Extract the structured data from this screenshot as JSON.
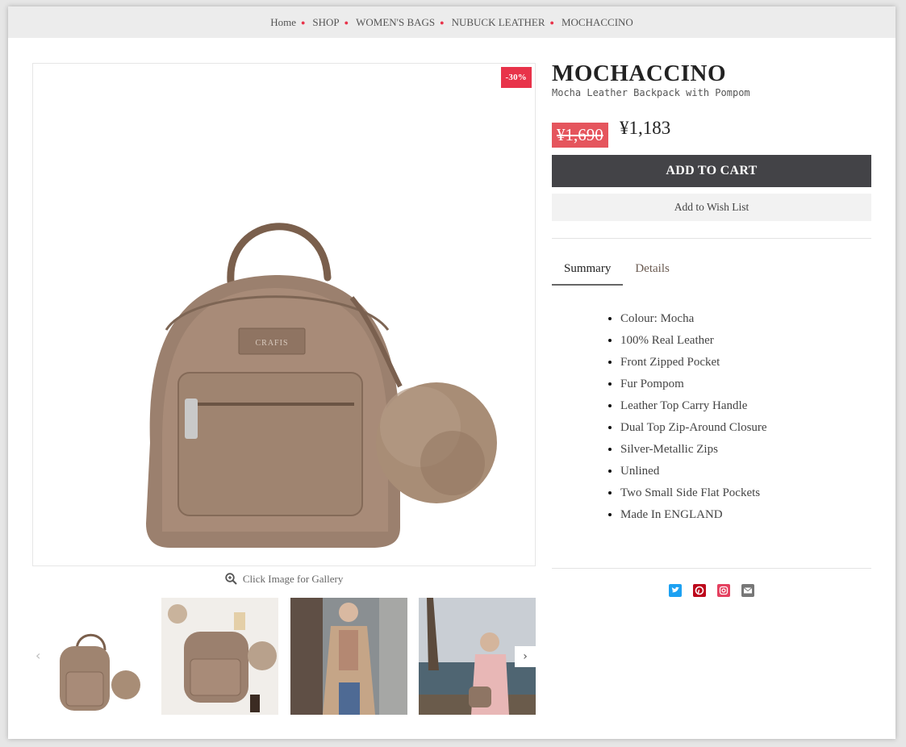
{
  "breadcrumb": [
    "Home",
    "SHOP",
    "WOMEN'S BAGS",
    "NUBUCK LEATHER",
    "MOCHACCINO"
  ],
  "product": {
    "badge": "-30%",
    "title": "MOCHACCINO",
    "subtitle": "Mocha Leather Backpack with Pompom",
    "old_price": "¥1,690",
    "new_price": "¥1,183",
    "add_to_cart": "ADD TO CART",
    "add_to_wishlist": "Add to Wish List"
  },
  "gallery": {
    "hint": "Click Image for Gallery",
    "prev_icon": "‹",
    "next_icon": "›"
  },
  "tabs": [
    {
      "label": "Summary",
      "active": true
    },
    {
      "label": "Details",
      "active": false
    }
  ],
  "summary": [
    "Colour: Mocha",
    "100% Real Leather",
    "Front Zipped Pocket",
    "Fur Pompom",
    "Leather Top Carry Handle",
    "Dual Top Zip-Around Closure",
    "Silver-Metallic Zips",
    "Unlined",
    "Two Small Side Flat Pockets",
    "Made In ENGLAND"
  ],
  "social": [
    {
      "name": "twitter-icon",
      "color": "#1da1f2"
    },
    {
      "name": "pinterest-icon",
      "color": "#bd081c"
    },
    {
      "name": "instagram-icon",
      "color": "#e4405f"
    },
    {
      "name": "email-icon",
      "color": "#777777"
    }
  ],
  "colors": {
    "accent": "#e8334a",
    "old_price_bg": "#e5555d",
    "cart_button": "#434347"
  }
}
